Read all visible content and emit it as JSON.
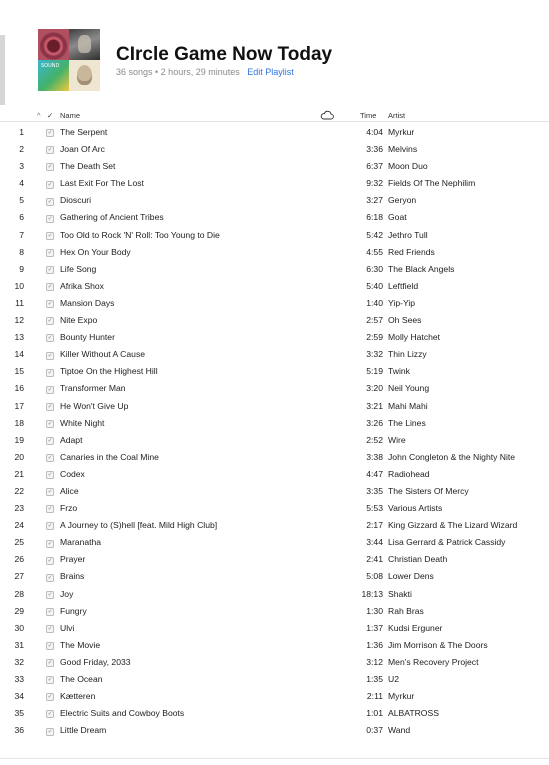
{
  "playlist": {
    "title": "CIrcle Game Now Today",
    "summary": "36 songs • 2 hours, 29 minutes",
    "edit_label": "Edit Playlist"
  },
  "columns": {
    "sort_indicator": "^",
    "check": "✓",
    "name": "Name",
    "cloud_icon": "cloud-icon",
    "time": "Time",
    "artist": "Artist"
  },
  "tracks": [
    {
      "num": "1",
      "name": "The Serpent",
      "time": "4:04",
      "artist": "Myrkur"
    },
    {
      "num": "2",
      "name": "Joan Of Arc",
      "time": "3:36",
      "artist": "Melvins"
    },
    {
      "num": "3",
      "name": "The Death Set",
      "time": "6:37",
      "artist": "Moon Duo"
    },
    {
      "num": "4",
      "name": "Last Exit For The Lost",
      "time": "9:32",
      "artist": "Fields Of The Nephilim"
    },
    {
      "num": "5",
      "name": "Dioscuri",
      "time": "3:27",
      "artist": "Geryon"
    },
    {
      "num": "6",
      "name": "Gathering of Ancient Tribes",
      "time": "6:18",
      "artist": "Goat"
    },
    {
      "num": "7",
      "name": "Too Old to Rock 'N' Roll: Too Young to Die",
      "time": "5:42",
      "artist": "Jethro Tull"
    },
    {
      "num": "8",
      "name": "Hex On Your Body",
      "time": "4:55",
      "artist": "Red Friends"
    },
    {
      "num": "9",
      "name": "Life Song",
      "time": "6:30",
      "artist": "The Black Angels"
    },
    {
      "num": "10",
      "name": "Afrika Shox",
      "time": "5:40",
      "artist": "Leftfield"
    },
    {
      "num": "11",
      "name": "Mansion Days",
      "time": "1:40",
      "artist": "Yip-Yip"
    },
    {
      "num": "12",
      "name": "Nite Expo",
      "time": "2:57",
      "artist": "Oh Sees"
    },
    {
      "num": "13",
      "name": "Bounty Hunter",
      "time": "2:59",
      "artist": "Molly Hatchet"
    },
    {
      "num": "14",
      "name": "Killer Without A Cause",
      "time": "3:32",
      "artist": "Thin Lizzy"
    },
    {
      "num": "15",
      "name": "Tiptoe On the Highest Hill",
      "time": "5:19",
      "artist": "Twink"
    },
    {
      "num": "16",
      "name": "Transformer Man",
      "time": "3:20",
      "artist": "Neil Young"
    },
    {
      "num": "17",
      "name": "He Won't Give Up",
      "time": "3:21",
      "artist": "Mahi Mahi"
    },
    {
      "num": "18",
      "name": "White Night",
      "time": "3:26",
      "artist": "The Lines"
    },
    {
      "num": "19",
      "name": "Adapt",
      "time": "2:52",
      "artist": "Wire"
    },
    {
      "num": "20",
      "name": "Canaries in the Coal Mine",
      "time": "3:38",
      "artist": "John Congleton & the Nighty Nite"
    },
    {
      "num": "21",
      "name": "Codex",
      "time": "4:47",
      "artist": "Radiohead"
    },
    {
      "num": "22",
      "name": "Alice",
      "time": "3:35",
      "artist": "The Sisters Of Mercy"
    },
    {
      "num": "23",
      "name": "Frzo",
      "time": "5:53",
      "artist": "Various Artists"
    },
    {
      "num": "24",
      "name": "A Journey to (S)hell [feat. Mild High Club]",
      "time": "2:17",
      "artist": "King Gizzard & The Lizard Wizard"
    },
    {
      "num": "25",
      "name": "Maranatha",
      "time": "3:44",
      "artist": "Lisa Gerrard & Patrick Cassidy"
    },
    {
      "num": "26",
      "name": "Prayer",
      "time": "2:41",
      "artist": "Christian Death"
    },
    {
      "num": "27",
      "name": "Brains",
      "time": "5:08",
      "artist": "Lower Dens"
    },
    {
      "num": "28",
      "name": "Joy",
      "time": "18:13",
      "artist": "Shakti"
    },
    {
      "num": "29",
      "name": "Fungry",
      "time": "1:30",
      "artist": "Rah Bras"
    },
    {
      "num": "30",
      "name": "Ulvi",
      "time": "1:37",
      "artist": "Kudsi Erguner"
    },
    {
      "num": "31",
      "name": "The Movie",
      "time": "1:36",
      "artist": "Jim Morrison & The Doors"
    },
    {
      "num": "32",
      "name": "Good Friday, 2033",
      "time": "3:12",
      "artist": "Men's Recovery Project"
    },
    {
      "num": "33",
      "name": "The Ocean",
      "time": "1:35",
      "artist": "U2"
    },
    {
      "num": "34",
      "name": "Kætteren",
      "time": "2:11",
      "artist": "Myrkur"
    },
    {
      "num": "35",
      "name": "Electric Suits and Cowboy Boots",
      "time": "1:01",
      "artist": "ALBATROSS"
    },
    {
      "num": "36",
      "name": "Little Dream",
      "time": "0:37",
      "artist": "Wand"
    }
  ],
  "checkmark_glyph": "✓",
  "colors": {
    "link": "#2d73e5",
    "meta": "#8a8a8a"
  }
}
